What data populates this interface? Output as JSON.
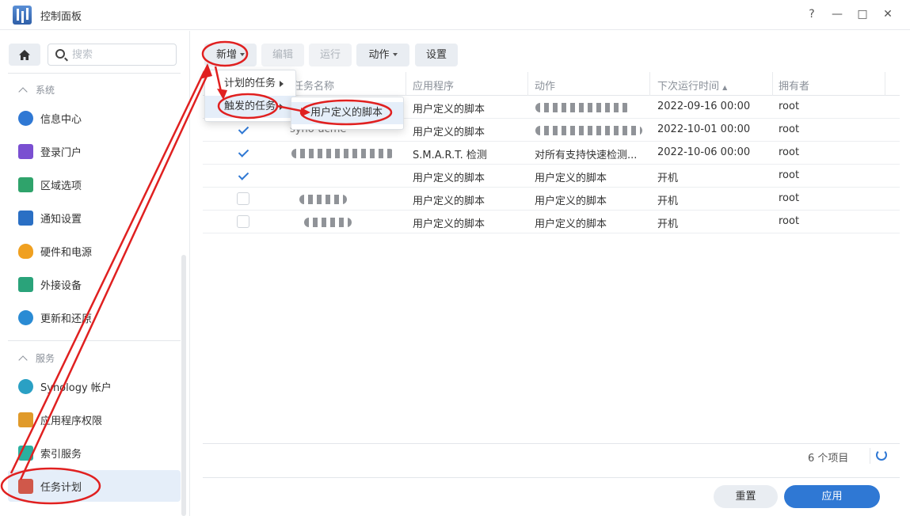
{
  "window": {
    "title": "控制面板",
    "help": "?",
    "minimize": "—",
    "maximize": "□",
    "close": "✕"
  },
  "sidebar": {
    "search_placeholder": "搜索",
    "groups": [
      {
        "label": "系统"
      },
      {
        "label": "服务"
      }
    ],
    "items": [
      {
        "label": "信息中心",
        "icon": "info-icon",
        "color": "#2f78d4"
      },
      {
        "label": "登录门户",
        "icon": "login-portal-icon",
        "color": "#7a4fd1"
      },
      {
        "label": "区域选项",
        "icon": "region-icon",
        "color": "#2fa36b"
      },
      {
        "label": "通知设置",
        "icon": "notification-icon",
        "color": "#2a6fc4"
      },
      {
        "label": "硬件和电源",
        "icon": "lightbulb-icon",
        "color": "#f0a020"
      },
      {
        "label": "外接设备",
        "icon": "external-device-icon",
        "color": "#2aa37a"
      },
      {
        "label": "更新和还原",
        "icon": "update-icon",
        "color": "#2a8bd4"
      },
      {
        "label": "Synology 帐户",
        "icon": "account-icon",
        "color": "#2aa0c4"
      },
      {
        "label": "应用程序权限",
        "icon": "lock-icon",
        "color": "#e09a2a"
      },
      {
        "label": "索引服务",
        "icon": "index-icon",
        "color": "#2ab0a0"
      },
      {
        "label": "任务计划",
        "icon": "calendar-icon",
        "color": "#d0584a"
      }
    ]
  },
  "toolbar": {
    "create": "新增",
    "edit": "编辑",
    "run": "运行",
    "action": "动作",
    "settings": "设置"
  },
  "create_menu": {
    "scheduled": "计划的任务",
    "triggered": "触发的任务",
    "submenu_user_script": "用户定义的脚本"
  },
  "table": {
    "headers": [
      "任务名称",
      "应用程序",
      "动作",
      "下次运行时间",
      "拥有者"
    ],
    "sort_indicator": "▲",
    "rows": [
      {
        "checked": true,
        "name": "",
        "app": "用户定义的脚本",
        "action": "",
        "next_run": "2022-09-16 00:00",
        "owner": "root"
      },
      {
        "checked": true,
        "name": "syno-acme",
        "app": "用户定义的脚本",
        "action": "",
        "next_run": "2022-10-01 00:00",
        "owner": "root"
      },
      {
        "checked": true,
        "name": "",
        "app": "S.M.A.R.T. 检测",
        "action": "对所有支持快速检测...",
        "next_run": "2022-10-06 00:00",
        "owner": "root"
      },
      {
        "checked": true,
        "name": "",
        "app": "用户定义的脚本",
        "action": "用户定义的脚本",
        "next_run": "开机",
        "owner": "root"
      },
      {
        "checked": false,
        "name": "",
        "app": "用户定义的脚本",
        "action": "用户定义的脚本",
        "next_run": "开机",
        "owner": "root"
      },
      {
        "checked": false,
        "name": "",
        "app": "用户定义的脚本",
        "action": "用户定义的脚本",
        "next_run": "开机",
        "owner": "root"
      }
    ]
  },
  "footer": {
    "item_count": "6 个项目",
    "reset": "重置",
    "apply": "应用"
  },
  "colors": {
    "accent": "#2f78d4",
    "annotation_red": "#e02020"
  }
}
